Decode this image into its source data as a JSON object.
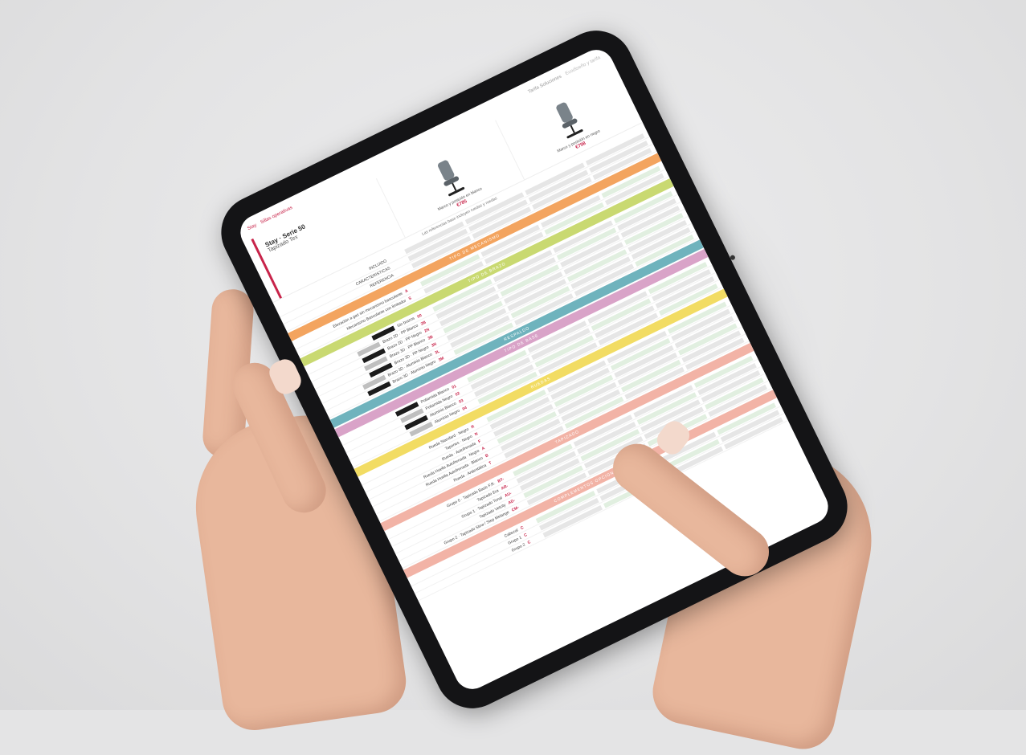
{
  "topbar": {
    "brand": "Stay",
    "section": "Sillas operativas",
    "right_1": "Tarifa Soluciones",
    "right_2": "Ecodiseño y tarifa"
  },
  "header": {
    "title": "Stay · Serie 50",
    "subtitle": "Tapizado Tex"
  },
  "products": [
    {
      "label": "Marco y posición en blanco",
      "price": "€785"
    },
    {
      "label": "Marco y posición en negro",
      "price": "€798"
    }
  ],
  "notice": "Las referencias base incluyen ruedas y ruedas",
  "left_labels": {
    "incluido": "INCLUIDO",
    "caracteristicas": "CARACTERÍSTICAS",
    "referencia": "REFERENCIA"
  },
  "sections": {
    "mecanismo": "TIPO DE MECANISMO",
    "brazo": "TIPO DE BRAZO",
    "respaldo": "RESPALDO",
    "base": "TIPO DE BASE",
    "ruedas": "RUEDAS",
    "tapizado": "TAPIZADO",
    "opcionales": "COMPLEMENTOS OPCIONALES"
  },
  "colors": {
    "accent": "#c8244a",
    "orange": "#f3a45f",
    "lime": "#c9d971",
    "teal": "#6fb3bd",
    "pink": "#d9a3c8",
    "yellow": "#f2dc63",
    "salmon": "#f2b3a6"
  },
  "rows_mecanismo": [
    {
      "label": "Elevación a gas sin mecanismo basculante",
      "code": "A"
    },
    {
      "label": "Mecanismo Basculante con limitador",
      "code": "S"
    }
  ],
  "rows_brazo": [
    {
      "label": "Sin brazos",
      "code": "00"
    },
    {
      "label": "Brazo 2D · PP Blanco",
      "code": "2B"
    },
    {
      "label": "Brazo 2D · PP Negro",
      "code": "2N"
    },
    {
      "label": "Brazo 3D · PP Blanco",
      "code": "3B"
    },
    {
      "label": "Brazo 3D · PP Negro",
      "code": "3N"
    },
    {
      "label": "Brazo 3D · Aluminio Blanco",
      "code": "3L"
    },
    {
      "label": "Brazo 3D · Aluminio Negro",
      "code": "3M"
    }
  ],
  "rows_base": [
    {
      "label": "Poliamida Blanco",
      "code": "01"
    },
    {
      "label": "Poliamida Negro",
      "code": "02"
    },
    {
      "label": "Aluminio Blanco",
      "code": "03"
    },
    {
      "label": "Aluminio Negro",
      "code": "04"
    }
  ],
  "rows_ruedas": [
    {
      "label": "Rueda Standard · Negro",
      "code": "R"
    },
    {
      "label": "Tapones · Negro",
      "code": "N"
    },
    {
      "label": "Rueda · Autofrenada",
      "code": "F"
    },
    {
      "label": "Rueda Huella Autofrenada · Negro",
      "code": "A"
    },
    {
      "label": "Rueda Huella Autofrenada · Blanco",
      "code": "B"
    },
    {
      "label": "Rueda · Antiestática",
      "code": "T"
    }
  ],
  "rows_tapizado": [
    {
      "label": "Grupo 0 · Tapizado Basic F.R.",
      "code": "BT-"
    },
    {
      "label": "Tapizado Era",
      "code": "AR-"
    },
    {
      "label": "Grupo 1 · Tapizado Tonal",
      "code": "AU-"
    },
    {
      "label": "Tapizado Velcity",
      "code": "AD-"
    },
    {
      "label": "Grupo 2 · Tapizado Slow / Step Melange",
      "code": "CM-"
    }
  ],
  "rows_opcionales": [
    {
      "label": "Cabezal",
      "code": "C"
    },
    {
      "label": "Grupo 1",
      "code": "C"
    },
    {
      "label": "Grupo 2",
      "code": "C"
    }
  ]
}
